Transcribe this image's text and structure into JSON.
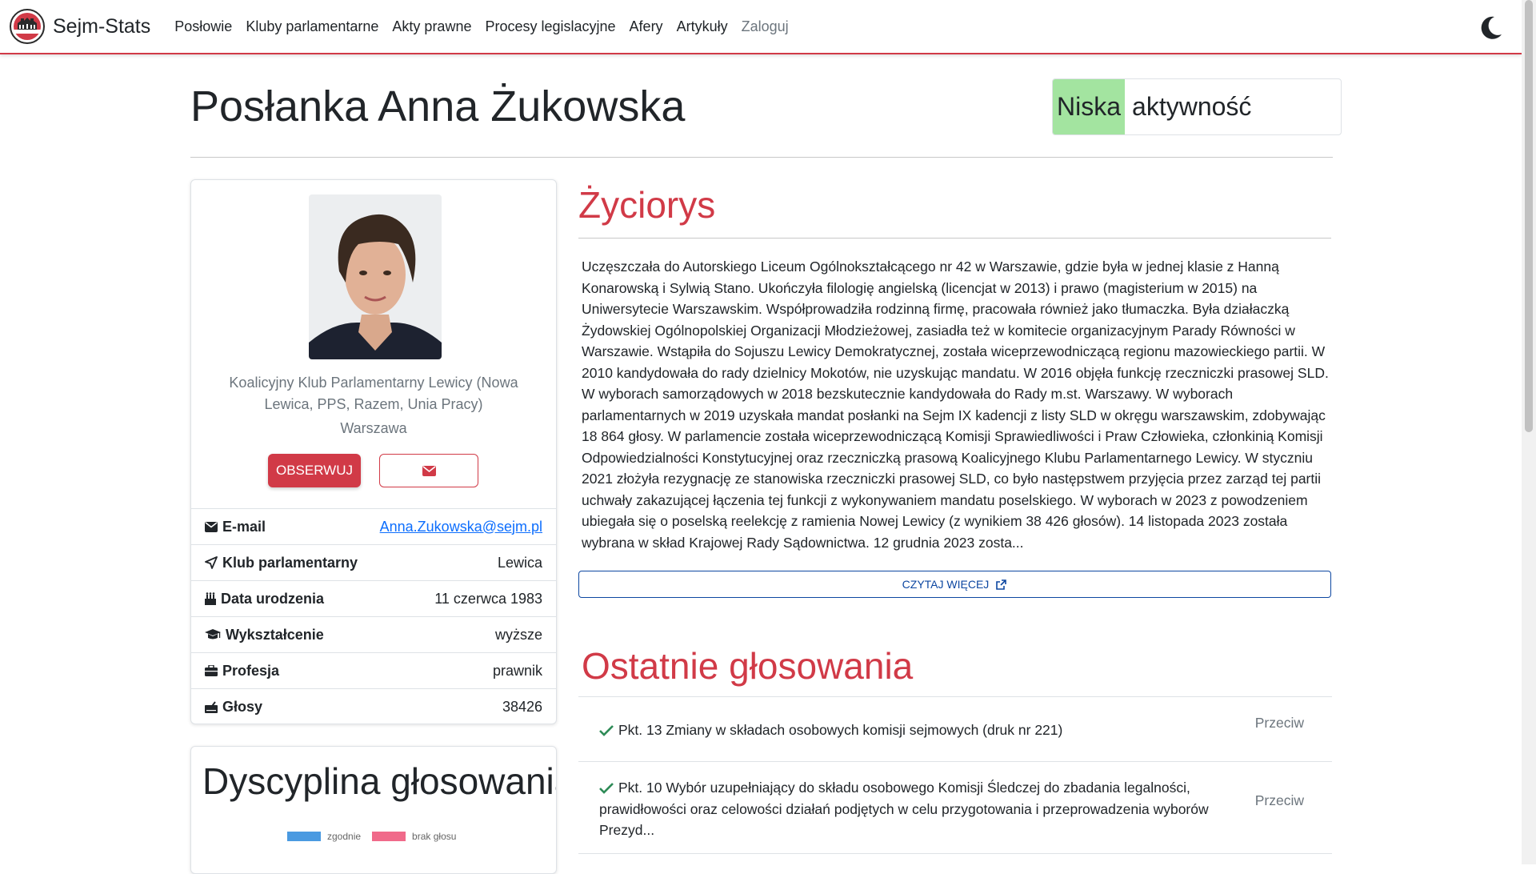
{
  "nav": {
    "brand": "Sejm-Stats",
    "links": [
      "Posłowie",
      "Kluby parlamentarne",
      "Akty prawne",
      "Procesy legislacyjne",
      "Afery",
      "Artykuły"
    ],
    "login": "Zaloguj"
  },
  "header": {
    "title": "Posłanka Anna Żukowska",
    "activity_level": "Niska",
    "activity_label": "aktywność",
    "activity_color": "#a3e4a0"
  },
  "profile": {
    "club_full": "Koalicyjny Klub Parlamentarny Lewicy (Nowa Lewica, PPS, Razem, Unia Pracy)",
    "city": "Warszawa",
    "follow_label": "OBSERWUJ",
    "info": [
      {
        "icon": "envelope-icon",
        "label": "E-mail",
        "value": "Anna.Zukowska@sejm.pl"
      },
      {
        "icon": "paper-plane-icon",
        "label": "Klub parlamentarny",
        "value": "Lewica"
      },
      {
        "icon": "birthday-cake-icon",
        "label": "Data urodzenia",
        "value": "11 czerwca 1983"
      },
      {
        "icon": "graduation-cap-icon",
        "label": "Wykształcenie",
        "value": "wyższe"
      },
      {
        "icon": "briefcase-icon",
        "label": "Profesja",
        "value": "prawnik"
      },
      {
        "icon": "vote-box-icon",
        "label": "Głosy",
        "value": "38426"
      }
    ]
  },
  "discipline": {
    "title": "Dyscyplina głosowania",
    "legend": [
      {
        "label": "zgodnie",
        "color": "#4a9ae1"
      },
      {
        "label": "brak głosu",
        "color": "#f06a8a"
      }
    ]
  },
  "bio": {
    "title": "Życiorys",
    "text": "Uczęszczała do Autorskiego Liceum Ogólnokształcącego nr 42 w Warszawie, gdzie była w jednej klasie z Hanną Konarowską i Sylwią Stano. Ukończyła filologię angielską (licencjat w 2013) i prawo (magisterium w 2015) na Uniwersytecie Warszawskim. Współprowadziła rodzinną firmę, pracowała również jako tłumaczka. Była działaczką Żydowskiej Ogólnopolskiej Organizacji Młodzieżowej, zasiadła też w komitecie organizacyjnym Parady Równości w Warszawie. Wstąpiła do Sojuszu Lewicy Demokratycznej, została wiceprzewodniczącą regionu mazowieckiego partii. W 2010 kandydowała do rady dzielnicy Mokotów, nie uzyskując mandatu. W 2016 objęła funkcję rzeczniczki prasowej SLD. W wyborach samorządowych w 2018 bezskutecznie kandydowała do Rady m.st. Warszawy. W wyborach parlamentarnych w 2019 uzyskała mandat posłanki na Sejm IX kadencji z listy SLD w okręgu warszawskim, zdobywając 18 864 głosy. W parlamencie została wiceprzewodniczącą Komisji Sprawiedliwości i Praw Człowieka, członkinią Komisji Odpowiedzialności Konstytucyjnej oraz rzeczniczką prasową Koalicyjnego Klubu Parlamentarnego Lewicy. W styczniu 2021 złożyła rezygnację ze stanowiska rzeczniczki prasowej SLD, co było następstwem przyjęcia przez zarząd tej partii uchwały zakazującej łączenia tej funkcji z wykonywaniem mandatu poselskiego. W wyborach w 2023 z powodzeniem ubiegała się o poselską reelekcję z ramienia Nowej Lewicy (z wynikiem 38 426 głosów). 14 listopada 2023 została wybrana w skład Krajowej Rady Sądownictwa. 12 grudnia 2023 zosta...",
    "read_more": "CZYTAJ WIĘCEJ"
  },
  "votes": {
    "title": "Ostatnie głosowania",
    "items": [
      {
        "text": "Pkt. 13 Zmiany w składach osobowych komisji sejmowych (druk nr 221)",
        "result": "Przeciw"
      },
      {
        "text": "Pkt. 10 Wybór uzupełniający do składu osobowego Komisji Śledczej do zbadania legalności, prawidłowości oraz celowości działań podjętych w celu przygotowania i przeprowadzenia wyborów Prezyd...",
        "result": "Przeciw"
      }
    ]
  }
}
